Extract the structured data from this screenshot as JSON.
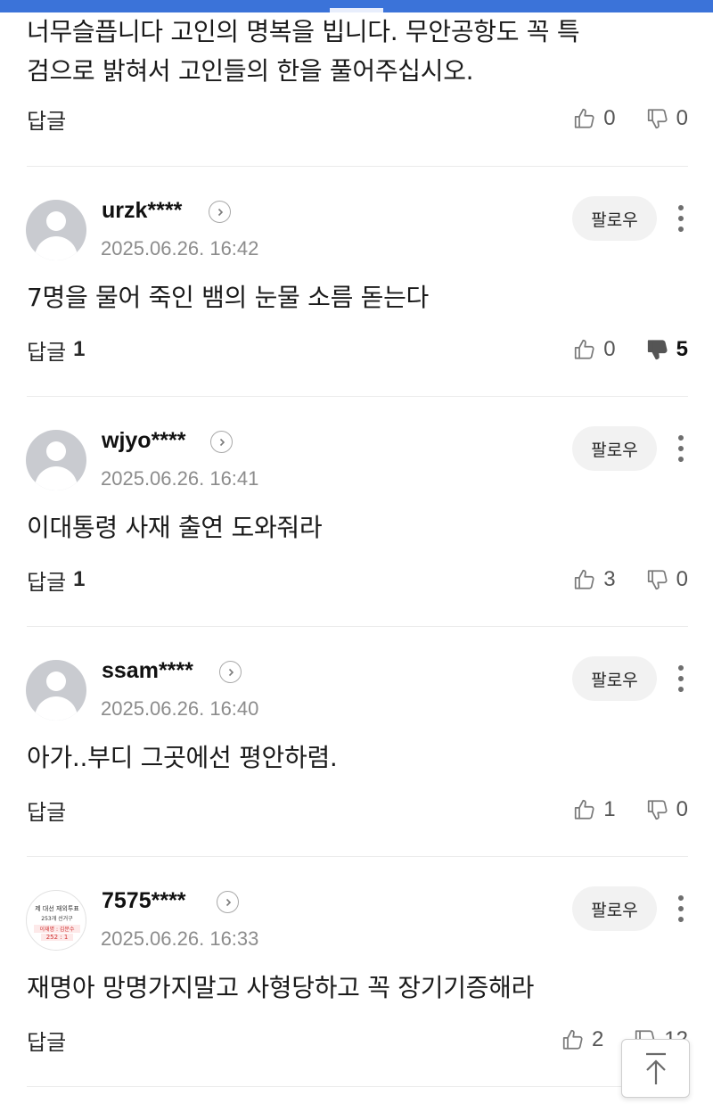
{
  "first_comment": {
    "text_line1": "너무슬픕니다 고인의 명복을 빕니다. 무안공항도 꼭 특",
    "text_line2": "검으로 밝혀서 고인들의 한을 풀어주십시오.",
    "reply_label": "답글",
    "likes": "0",
    "dislikes": "0"
  },
  "follow_label": "팔로우",
  "reply_label": "답글",
  "comments": [
    {
      "username": "urzk****",
      "timestamp": "2025.06.26. 16:42",
      "text": "7명을 물어 죽인 뱀의 눈물 소름 돋는다",
      "replies": "1",
      "likes": "0",
      "dislikes": "5"
    },
    {
      "username": "wjyo****",
      "timestamp": "2025.06.26. 16:41",
      "text": "이대통령 사재 출연 도와줘라",
      "replies": "1",
      "likes": "3",
      "dislikes": "0"
    },
    {
      "username": "ssam****",
      "timestamp": "2025.06.26. 16:40",
      "text": "아가..부디 그곳에선 평안하렴.",
      "replies": "",
      "likes": "1",
      "dislikes": "0"
    },
    {
      "username": "7575****",
      "timestamp": "2025.06.26. 16:33",
      "text": "재명아 망명가지말고 사형당하고 꼭 장기기증해라",
      "replies": "",
      "likes": "2",
      "dislikes": "12"
    }
  ],
  "poster_avatar": {
    "line1": "제 대선 재외투표",
    "line2": "253개 선거구",
    "line3": "이재명 : 김문수",
    "line4": "252 : 1"
  },
  "colors": {
    "accent": "#3b73d9",
    "muted": "#8c8c8c",
    "divider": "#ebebeb",
    "pill": "#f2f2f2"
  },
  "icons": [
    "thumb-up-icon",
    "thumb-down-icon",
    "chevron-right-icon",
    "more-vertical-icon",
    "arrow-up-icon",
    "default-avatar-icon"
  ]
}
